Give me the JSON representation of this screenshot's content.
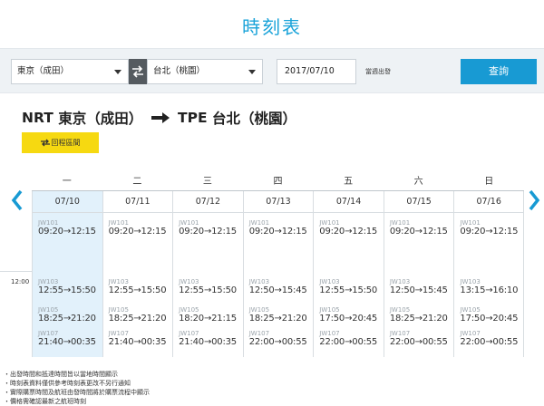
{
  "page_title": "時刻表",
  "search": {
    "from": "東京（成田）",
    "to": "台北（桃園）",
    "date": "2017/07/10",
    "week_label": "當週出發",
    "search_label": "查詢"
  },
  "route": {
    "from_code": "NRT",
    "from_name": "東京（成田）",
    "to_code": "TPE",
    "to_name": "台北（桃園）"
  },
  "return_label": "回程區間",
  "weekdays": [
    "一",
    "二",
    "三",
    "四",
    "五",
    "六",
    "日"
  ],
  "days": [
    {
      "date": "07/10",
      "today": true,
      "flights": [
        {
          "no": "JW101",
          "time": "09:20→12:15"
        },
        {
          "no": "JW103",
          "time": "12:55→15:50"
        },
        {
          "no": "JW105",
          "time": "18:25→21:20"
        },
        {
          "no": "JW107",
          "time": "21:40→00:35"
        }
      ]
    },
    {
      "date": "07/11",
      "today": false,
      "flights": [
        {
          "no": "JW101",
          "time": "09:20→12:15"
        },
        {
          "no": "JW103",
          "time": "12:55→15:50"
        },
        {
          "no": "JW105",
          "time": "18:25→21:20"
        },
        {
          "no": "JW107",
          "time": "21:40→00:35"
        }
      ]
    },
    {
      "date": "07/12",
      "today": false,
      "flights": [
        {
          "no": "JW101",
          "time": "09:20→12:15"
        },
        {
          "no": "JW103",
          "time": "12:55→15:50"
        },
        {
          "no": "JW105",
          "time": "18:20→21:15"
        },
        {
          "no": "JW107",
          "time": "21:40→00:35"
        }
      ]
    },
    {
      "date": "07/13",
      "today": false,
      "flights": [
        {
          "no": "JW101",
          "time": "09:20→12:15"
        },
        {
          "no": "JW103",
          "time": "12:50→15:45"
        },
        {
          "no": "JW105",
          "time": "18:25→21:20"
        },
        {
          "no": "JW107",
          "time": "22:00→00:55"
        }
      ]
    },
    {
      "date": "07/14",
      "today": false,
      "flights": [
        {
          "no": "JW101",
          "time": "09:20→12:15"
        },
        {
          "no": "JW103",
          "time": "12:55→15:50"
        },
        {
          "no": "JW105",
          "time": "17:50→20:45"
        },
        {
          "no": "JW107",
          "time": "22:00→00:55"
        }
      ]
    },
    {
      "date": "07/15",
      "today": false,
      "flights": [
        {
          "no": "JW101",
          "time": "09:20→12:15"
        },
        {
          "no": "JW103",
          "time": "12:50→15:45"
        },
        {
          "no": "JW105",
          "time": "18:25→21:20"
        },
        {
          "no": "JW107",
          "time": "22:00→00:55"
        }
      ]
    },
    {
      "date": "07/16",
      "today": false,
      "flights": [
        {
          "no": "JW101",
          "time": "09:20→12:15"
        },
        {
          "no": "JW103",
          "time": "13:15→16:10"
        },
        {
          "no": "JW105",
          "time": "17:50→20:45"
        },
        {
          "no": "JW107",
          "time": "22:00→00:55"
        }
      ]
    }
  ],
  "time_marker": "12:00",
  "notes": [
    "・出發時間和抵達時間皆以當地時間顯示",
    "・時刻表資料僅供參考時刻表更改不另行通知",
    "・實際購票時間及航班由發時間將於購票流程中顯示",
    "・價格需確認最新之航班時刻"
  ],
  "colors": {
    "accent": "#1aa3d9",
    "search_button": "#189ad3",
    "return_button": "#f6d911",
    "today_column": "#e2f1fb"
  }
}
